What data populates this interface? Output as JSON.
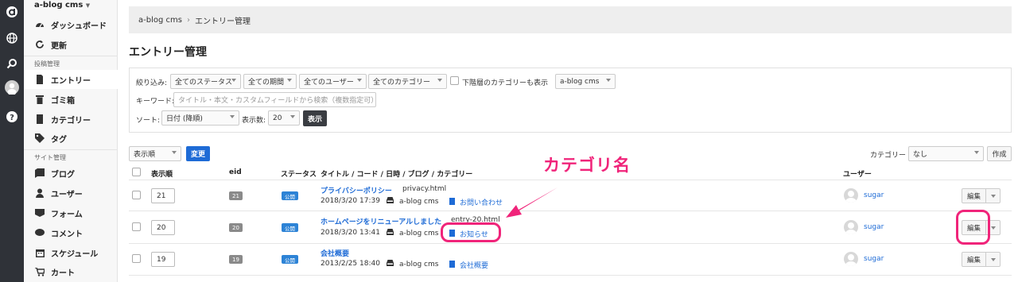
{
  "sidebar": {
    "site_name": "a-blog cms",
    "top_items": [
      {
        "label": "ダッシュボード",
        "icon": "dashboard-icon"
      },
      {
        "label": "更新",
        "icon": "refresh-icon"
      }
    ],
    "group1_label": "投稿管理",
    "group1_items": [
      {
        "label": "エントリー",
        "icon": "entry-icon"
      },
      {
        "label": "ゴミ箱",
        "icon": "trash-icon"
      },
      {
        "label": "カテゴリー",
        "icon": "category-icon"
      },
      {
        "label": "タグ",
        "icon": "tag-icon"
      }
    ],
    "group2_label": "サイト管理",
    "group2_items": [
      {
        "label": "ブログ",
        "icon": "blog-icon"
      },
      {
        "label": "ユーザー",
        "icon": "user-icon"
      },
      {
        "label": "フォーム",
        "icon": "form-icon"
      },
      {
        "label": "コメント",
        "icon": "comment-icon"
      },
      {
        "label": "スケジュール",
        "icon": "calendar-icon"
      },
      {
        "label": "カート",
        "icon": "cart-icon"
      }
    ]
  },
  "breadcrumb": {
    "root": "a-blog cms",
    "current": "エントリー管理"
  },
  "page_title": "エントリー管理",
  "filter": {
    "narrow_label": "絞り込み:",
    "status": "全てのステータス",
    "period": "全ての期間",
    "user": "全てのユーザー",
    "category": "全てのカテゴリー",
    "subcat_label": "下階層のカテゴリーも表示",
    "blog": "a-blog cms",
    "keyword_label": "キーワード:",
    "keyword_placeholder": "タイトル・本文・カスタムフィールドから検索（複数指定可）",
    "sort_label": "ソート:",
    "sort_value": "日付 (降順)",
    "count_label": "表示数:",
    "count_value": "20",
    "show_button": "表示"
  },
  "bulk": {
    "order_select": "表示順",
    "change_button": "変更",
    "category_label": "カテゴリー",
    "category_value": "なし",
    "create_button": "作成"
  },
  "table": {
    "headers": {
      "order": "表示順",
      "eid": "eid",
      "status": "ステータス",
      "title": "タイトル / コード / 日時 / ブログ / カテゴリー",
      "user": "ユーザー"
    },
    "rows": [
      {
        "order": "21",
        "eid": "21",
        "status": "公開",
        "title": "プライバシーポリシー",
        "code": "privacy.html",
        "date": "2018/3/20 17:39",
        "blog": "a-blog cms",
        "category": "お問い合わせ",
        "user": "sugar",
        "edit": "編集"
      },
      {
        "order": "20",
        "eid": "20",
        "status": "公開",
        "title": "ホームページをリニューアルしました",
        "code": "entry-20.html",
        "date": "2018/3/20 13:41",
        "blog": "a-blog cms",
        "category": "お知らせ",
        "user": "sugar",
        "edit": "編集"
      },
      {
        "order": "19",
        "eid": "19",
        "status": "公開",
        "title": "会社概要",
        "code": "",
        "date": "2013/2/25 18:40",
        "blog": "a-blog cms",
        "category": "会社概要",
        "user": "sugar",
        "edit": "編集"
      }
    ]
  },
  "annotation": "カテゴリ名",
  "colors": {
    "accent": "#1e6bd6",
    "annotation": "#f0247a",
    "rail": "#2f3238"
  }
}
